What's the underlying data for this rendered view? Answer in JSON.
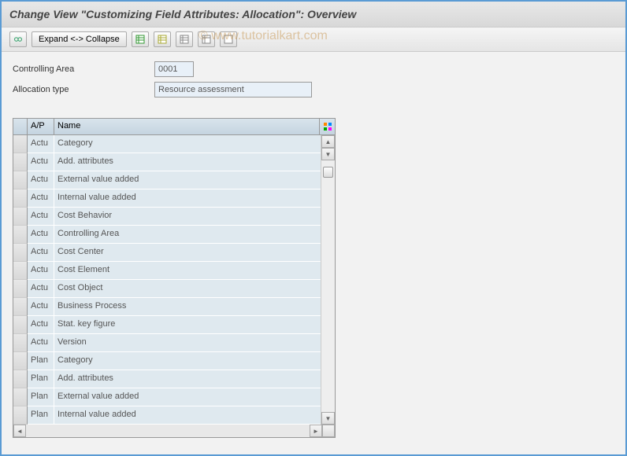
{
  "title": "Change View \"Customizing Field Attributes: Allocation\": Overview",
  "watermark": "© www.tutorialkart.com",
  "toolbar": {
    "expand_collapse_label": "Expand <-> Collapse"
  },
  "form": {
    "controlling_area_label": "Controlling Area",
    "controlling_area_value": "0001",
    "allocation_type_label": "Allocation type",
    "allocation_type_value": "Resource assessment"
  },
  "table": {
    "header": {
      "ap": "A/P",
      "name": "Name"
    },
    "rows": [
      {
        "ap": "Actu",
        "name": "Category"
      },
      {
        "ap": "Actu",
        "name": "Add. attributes"
      },
      {
        "ap": "Actu",
        "name": "External value added"
      },
      {
        "ap": "Actu",
        "name": "Internal value added"
      },
      {
        "ap": "Actu",
        "name": "Cost Behavior"
      },
      {
        "ap": "Actu",
        "name": "Controlling Area"
      },
      {
        "ap": "Actu",
        "name": "Cost Center"
      },
      {
        "ap": "Actu",
        "name": "Cost Element"
      },
      {
        "ap": "Actu",
        "name": "Cost Object"
      },
      {
        "ap": "Actu",
        "name": "Business Process"
      },
      {
        "ap": "Actu",
        "name": "Stat. key figure"
      },
      {
        "ap": "Actu",
        "name": "Version"
      },
      {
        "ap": "Plan",
        "name": "Category"
      },
      {
        "ap": "Plan",
        "name": "Add. attributes"
      },
      {
        "ap": "Plan",
        "name": "External value added"
      },
      {
        "ap": "Plan",
        "name": "Internal value added"
      }
    ]
  }
}
